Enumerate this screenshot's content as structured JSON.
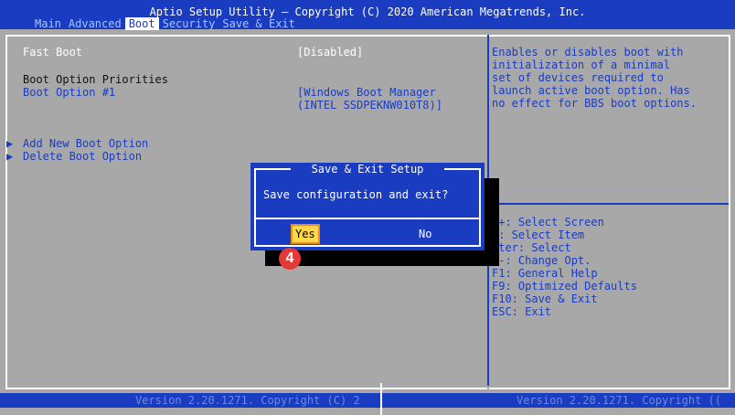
{
  "header": {
    "title": "Aptio Setup Utility – Copyright (C) 2020 American Megatrends, Inc.",
    "tabs": [
      "Main",
      "Advanced",
      "Boot",
      "Security",
      "Save & Exit"
    ],
    "active_tab": "Boot"
  },
  "settings": {
    "fast_boot": {
      "label": "Fast Boot",
      "value": "[Disabled]"
    },
    "priorities_heading": "Boot Option Priorities",
    "boot_option_1": {
      "label": "Boot Option #1",
      "value_line1": "[Windows Boot Manager",
      "value_line2": "(INTEL SSDPEKNW010T8)]"
    },
    "add_new": "Add New Boot Option",
    "delete": "Delete Boot Option"
  },
  "help": {
    "lines": [
      "Enables or disables boot with",
      "initialization of a minimal",
      "set of devices required to",
      "launch active boot option. Has",
      "no effect for BBS boot options."
    ]
  },
  "keys": [
    "++: Select Screen",
    "↓: Select Item",
    "nter: Select",
    "/-: Change Opt.",
    "F1: General Help",
    "F9: Optimized Defaults",
    "F10: Save & Exit",
    "ESC: Exit"
  ],
  "dialog": {
    "title": "Save & Exit Setup",
    "message": "Save configuration and exit?",
    "yes": "Yes",
    "no": "No"
  },
  "badge": "4",
  "footer": {
    "left": "Version 2.20.1271. Copyright (C) 2",
    "right": "Version 2.20.1271. Copyright (("
  },
  "colors": {
    "bios_blue": "#1a3cc0",
    "bios_gray": "#a8a8a8",
    "badge_red": "#e53935",
    "yes_highlight": "#ffd84a"
  }
}
